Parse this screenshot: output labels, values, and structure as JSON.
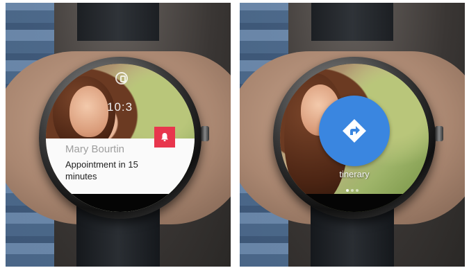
{
  "left_watch": {
    "time": "10:3",
    "notification": {
      "name": "Mary Bourtin",
      "message": "Appointment in 15 minutes"
    },
    "badge_icon": "alarm-bell-icon",
    "accent_color": "#e8364d"
  },
  "right_watch": {
    "action_icon": "navigation-directions-icon",
    "action_label": "tinerary",
    "action_color": "#3a86e0",
    "page_indicator": {
      "count": 3,
      "current": 1
    }
  }
}
